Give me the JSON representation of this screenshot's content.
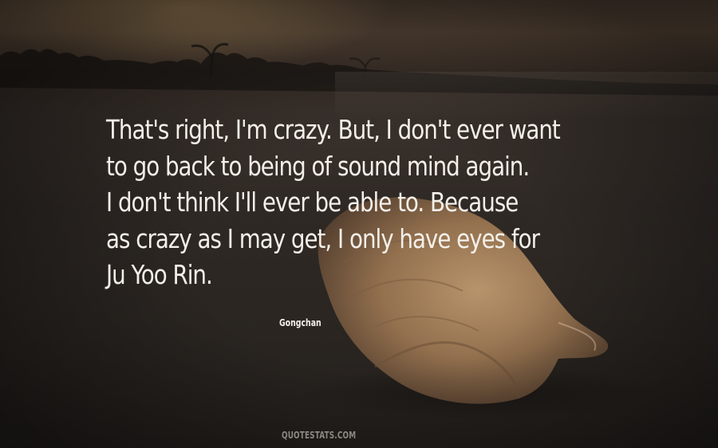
{
  "quote": {
    "lines": [
      "That's right, I'm crazy. But, I don't ever want",
      "to go back to being of sound mind again.",
      "I don't think I'll ever be able to. Because",
      "as crazy as I may get, I only have eyes for",
      "Ju Yoo Rin."
    ]
  },
  "author": "Gongchan",
  "watermark": "QUOTESTATS.COM",
  "colors": {
    "text": "#f4efe9",
    "watermark": "#8d8781",
    "shell": "#b08a62"
  }
}
